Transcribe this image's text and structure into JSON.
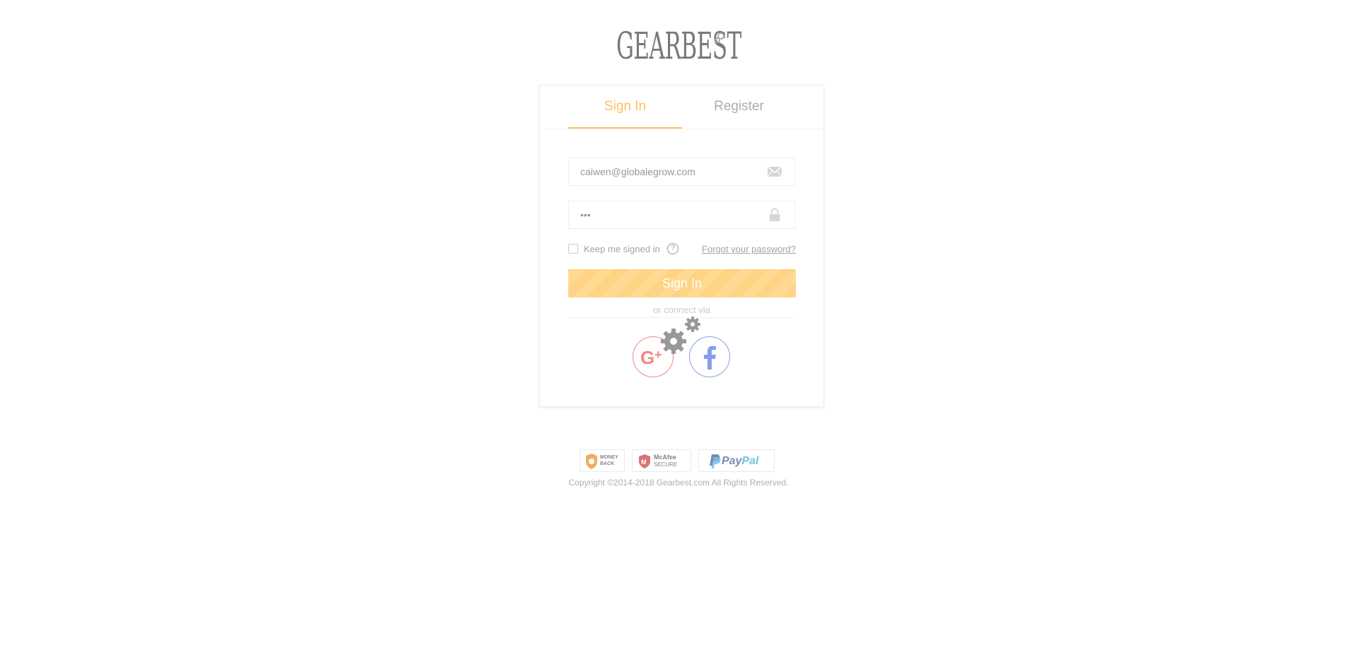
{
  "brand": {
    "logo_text": "GEARBEST"
  },
  "auth": {
    "tabs": [
      {
        "label": "Sign In",
        "active": true
      },
      {
        "label": "Register",
        "active": false
      }
    ],
    "email": {
      "value": "caiwen@globalegrow.com",
      "icon": "envelope-icon"
    },
    "password": {
      "value": "•••",
      "icon": "lock-icon"
    },
    "remember": {
      "label": "Keep me signed in",
      "checked": false,
      "help_glyph": "?"
    },
    "forgot_label": "Forgot your password?",
    "submit_label": "Sign In",
    "divider_label": "or connect via",
    "social": [
      {
        "name": "google-plus",
        "icon": "google-plus-icon",
        "color": "#e53935"
      },
      {
        "name": "facebook",
        "icon": "facebook-icon",
        "color": "#3b5fd9"
      }
    ],
    "loading_indicator": "gears-icon"
  },
  "footer": {
    "badges": [
      {
        "name": "money-back",
        "line1": "MONEY",
        "line2": "BACK"
      },
      {
        "name": "mcafee-secure",
        "line1": "McAfee",
        "line2": "SECURE"
      },
      {
        "name": "paypal",
        "part1": "Pay",
        "part2": "Pal"
      }
    ],
    "copyright": "Copyright ©2014-2018 Gearbest.com All Rights Reserved."
  },
  "colors": {
    "accent": "#ff9400",
    "button": "#ffb633",
    "google": "#e53935",
    "facebook": "#3b5fd9"
  }
}
